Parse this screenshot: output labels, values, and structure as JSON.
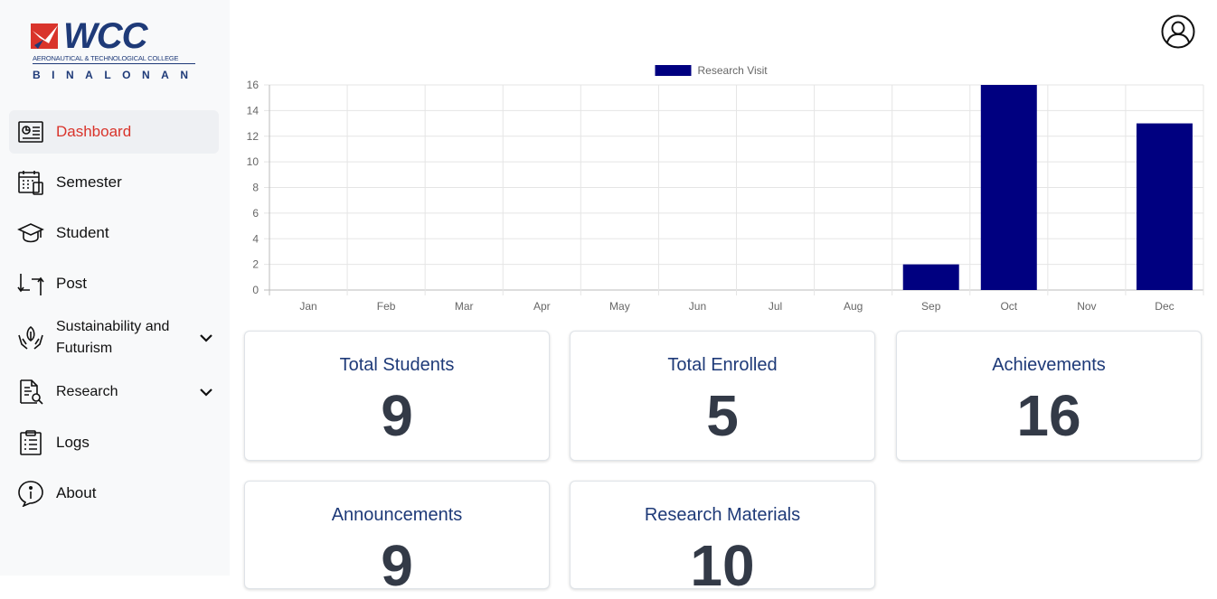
{
  "brand": {
    "name": "WCC",
    "subtitle": "AERONAUTICAL & TECHNOLOGICAL COLLEGE",
    "city": "BINALONAN"
  },
  "sidebar": {
    "items": [
      {
        "label": "Dashboard",
        "icon": "dashboard-icon",
        "active": true
      },
      {
        "label": "Semester",
        "icon": "calendar-icon"
      },
      {
        "label": "Student",
        "icon": "graduation-cap-icon"
      },
      {
        "label": "Post",
        "icon": "post-arrows-icon"
      },
      {
        "label": "Sustainability and Futurism",
        "icon": "hands-leaf-icon",
        "expandable": true
      },
      {
        "label": "Research",
        "icon": "document-search-icon",
        "expandable": true
      },
      {
        "label": "Logs",
        "icon": "clipboard-icon"
      },
      {
        "label": "About",
        "icon": "info-icon"
      }
    ]
  },
  "colors": {
    "accent": "#d9342b",
    "brand": "#1e3a78",
    "bar": "#000080",
    "value": "#333a47"
  },
  "chart_data": {
    "type": "bar",
    "categories": [
      "Jan",
      "Feb",
      "Mar",
      "Apr",
      "May",
      "Jun",
      "Jul",
      "Aug",
      "Sep",
      "Oct",
      "Nov",
      "Dec"
    ],
    "series": [
      {
        "name": "Research Visit",
        "values": [
          0,
          0,
          0,
          0,
          0,
          0,
          0,
          0,
          2,
          16,
          0,
          13
        ]
      }
    ],
    "ylim": [
      0,
      16
    ],
    "yticks": [
      0,
      2,
      4,
      6,
      8,
      10,
      12,
      14,
      16
    ],
    "grid": true,
    "legend": "top-center"
  },
  "cards": [
    {
      "title": "Total Students",
      "value": "9"
    },
    {
      "title": "Total Enrolled",
      "value": "5"
    },
    {
      "title": "Achievements",
      "value": "16"
    },
    {
      "title": "Announcements",
      "value": "9"
    },
    {
      "title": "Research Materials",
      "value": "10"
    }
  ]
}
